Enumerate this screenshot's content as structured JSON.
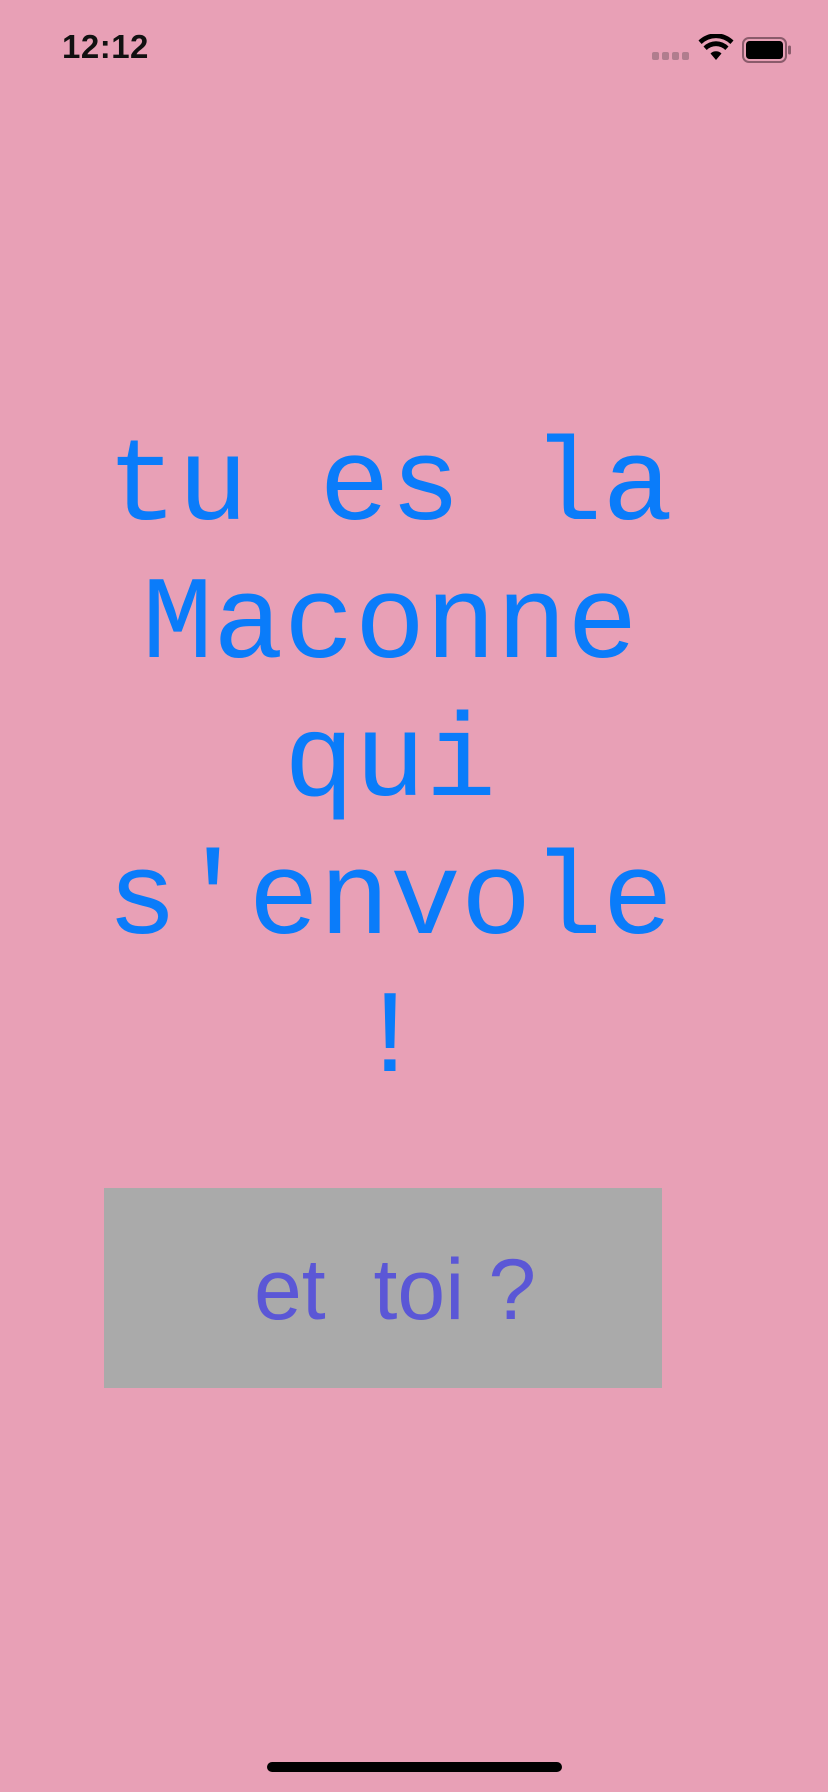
{
  "status_bar": {
    "time": "12:12",
    "icons": [
      "signal-icon",
      "wifi-icon",
      "battery-icon"
    ]
  },
  "main": {
    "headline_lines": [
      "tu es la",
      "Maconne",
      "qui",
      "s'envole !"
    ]
  },
  "action_button": {
    "label": "et  toi ?"
  },
  "colors": {
    "background": "#e8a0b6",
    "headline": "#0a7cfa",
    "button_background": "#aaaaaa",
    "button_text": "#5b57d6"
  }
}
